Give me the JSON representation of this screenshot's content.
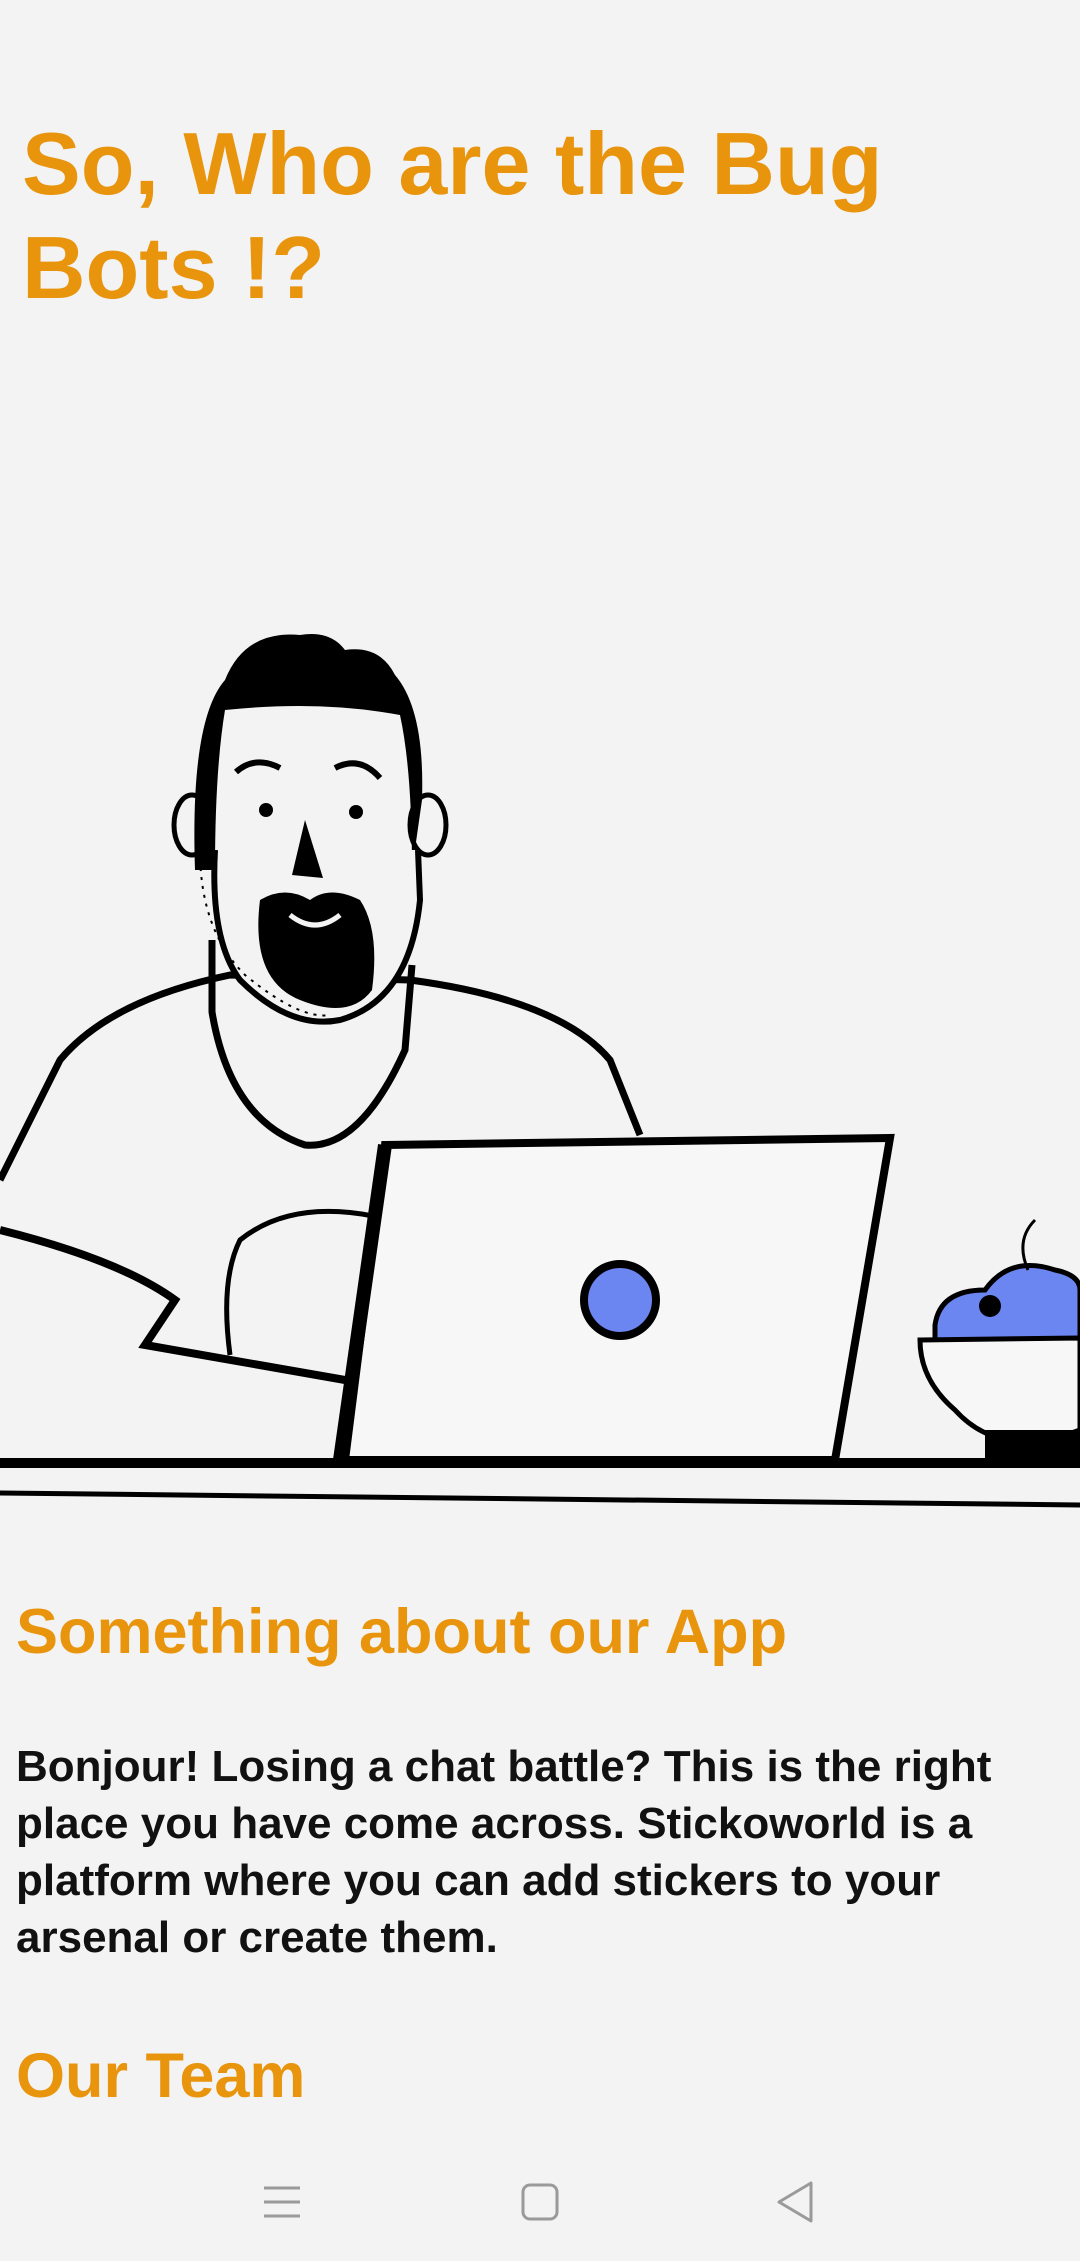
{
  "page": {
    "title": "So, Who are the Bug Bots !?"
  },
  "about": {
    "heading": "Something about our App",
    "text": "Bonjour! Losing a chat battle? This is the right place you have come across. Stickoworld is a platform where you can add stickers to your arsenal or create them."
  },
  "team": {
    "heading": "Our Team"
  },
  "colors": {
    "accent": "#e8940c",
    "body_text": "#111111",
    "background": "#f3f3f3",
    "illustration_blue": "#6b86f0"
  },
  "navbar": {
    "icons": [
      "menu-icon",
      "home-square-icon",
      "back-triangle-icon"
    ]
  }
}
